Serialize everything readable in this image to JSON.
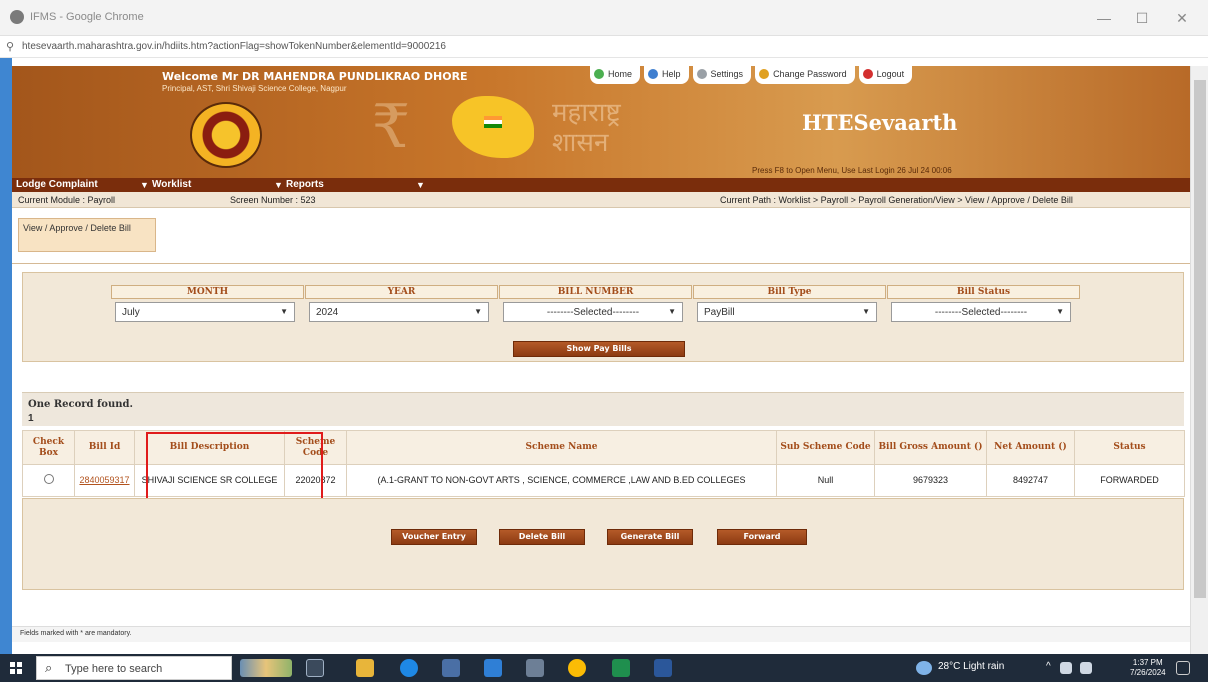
{
  "browser": {
    "title": "IFMS - Google Chrome",
    "url": "htesevaarth.maharashtra.gov.in/hdiits.htm?actionFlag=showTokenNumber&elementId=9000216",
    "minimize": "—",
    "maximize": "☐",
    "close": "✕"
  },
  "banner": {
    "welcome": "Welcome Mr DR MAHENDRA PUNDLIKRAO DHORE",
    "principal": "Principal, AST, Shri Shivaji Science College, Nagpur",
    "marathi_line1": "महाराष्ट्र",
    "marathi_line2": "शासन",
    "brand": "HTESevaarth",
    "last_login": "Press F8 to Open Menu, Use Last Login 26 Jul 24 00:06",
    "rupee_symbol": "₹"
  },
  "topnav": {
    "home": "Home",
    "help": "Help",
    "settings": "Settings",
    "change_password": "Change Password",
    "logout": "Logout"
  },
  "menubar": {
    "lodge_complaint": "Lodge Complaint",
    "worklist": "Worklist",
    "reports": "Reports",
    "marker": "▼"
  },
  "infobar": {
    "module": "Current Module : Payroll",
    "screen": "Screen Number : 523",
    "path": "Current Path : Worklist > Payroll > Payroll Generation/View > View / Approve / Delete Bill"
  },
  "tab": {
    "label": "View / Approve / Delete Bill"
  },
  "filters": {
    "month": {
      "label": "MONTH",
      "value": "July"
    },
    "year": {
      "label": "YEAR",
      "value": "2024"
    },
    "bill_number": {
      "label": "BILL NUMBER",
      "value": "--------Selected--------"
    },
    "bill_type": {
      "label": "Bill Type",
      "value": "PayBill"
    },
    "bill_status": {
      "label": "Bill Status",
      "value": "--------Selected--------"
    },
    "show_button": "Show Pay Bills",
    "dropdown_arrow": "▼"
  },
  "records": {
    "found_text": "One Record found.",
    "count": "1"
  },
  "table": {
    "headers": [
      "Check Box",
      "Bill Id",
      "Bill Description",
      "Scheme Code",
      "Scheme Name",
      "Sub Scheme Code",
      "Bill Gross Amount ()",
      "Net Amount ()",
      "Status"
    ],
    "rows": [
      {
        "bill_id": "2840059317",
        "description": "SHIVAJI SCIENCE SR COLLEGE",
        "scheme_code": "22020872",
        "scheme_name": "(A.1-GRANT TO NON-GOVT ARTS , SCIENCE, COMMERCE ,LAW AND B.ED COLLEGES",
        "sub_scheme_code": "Null",
        "gross_amount": "9679323",
        "net_amount": "8492747",
        "status": "FORWARDED"
      }
    ]
  },
  "actions": {
    "voucher_entry": "Voucher Entry",
    "delete_bill": "Delete Bill",
    "generate_bill": "Generate Bill",
    "forward": "Forward"
  },
  "footer": {
    "note": "Fields marked with * are mandatory."
  },
  "taskbar": {
    "search_placeholder": "Type here to search",
    "weather": "28°C  Light rain",
    "time": "1:37 PM",
    "date": "7/26/2024",
    "tray_arrow": "^"
  }
}
